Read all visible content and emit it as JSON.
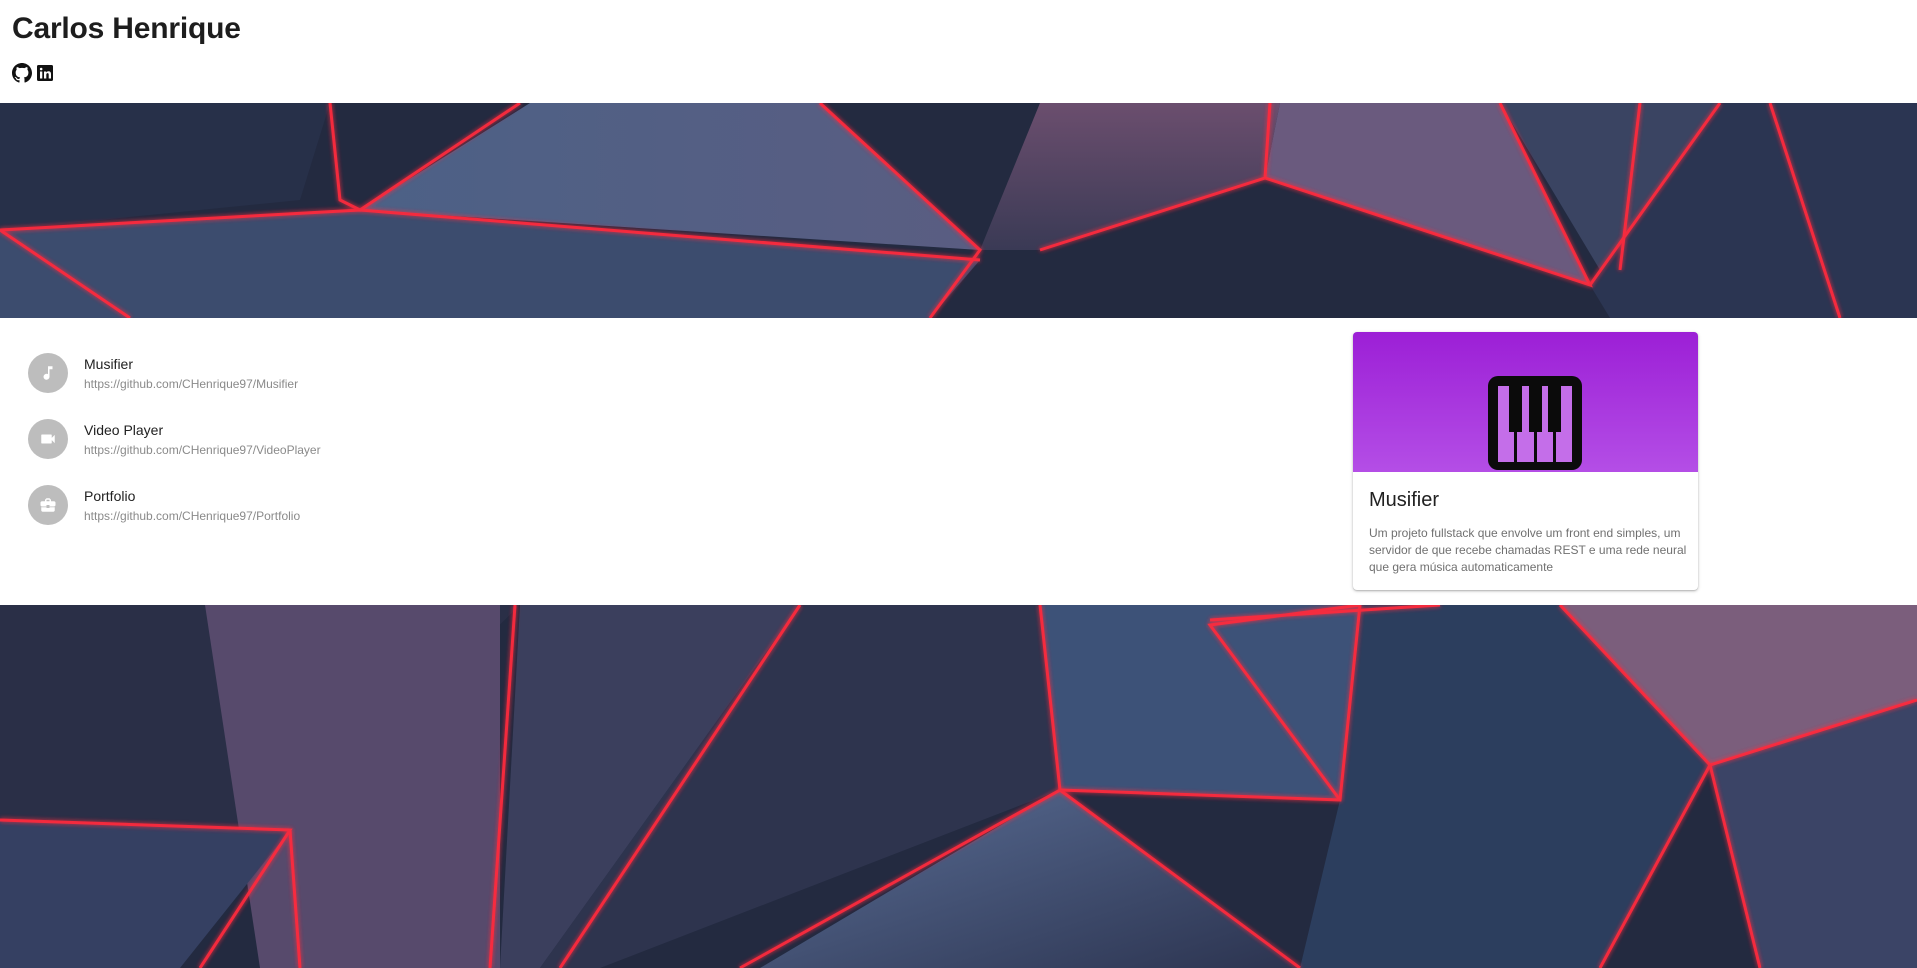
{
  "header": {
    "title": "Carlos Henrique",
    "social": [
      {
        "icon": "github-icon"
      },
      {
        "icon": "linkedin-icon"
      }
    ]
  },
  "projects": [
    {
      "name": "Musifier",
      "url": "https://github.com/CHenrique97/Musifier",
      "icon": "music-note-icon"
    },
    {
      "name": "Video Player",
      "url": "https://github.com/CHenrique97/VideoPlayer",
      "icon": "video-camera-icon"
    },
    {
      "name": "Portfolio",
      "url": "https://github.com/CHenrique97/Portfolio",
      "icon": "briefcase-icon"
    }
  ],
  "card": {
    "title": "Musifier",
    "description": "Um projeto fullstack que envolve um front end simples, um servidor de que recebe chamadas REST e uma rede neural que gera música automaticamente",
    "icon": "piano-icon"
  },
  "colors": {
    "card_gradient_top": "#9c1fd6",
    "card_gradient_bottom": "#b44ee6",
    "avatar_bg": "#bdbdbd",
    "neon_red": "#ff2a3c",
    "bg_dark": "#1f2436"
  }
}
